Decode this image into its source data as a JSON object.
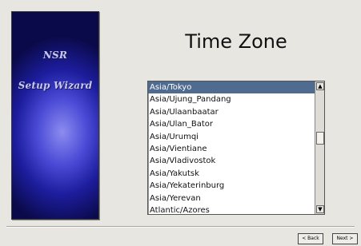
{
  "sidebar": {
    "brand_line1": "NSR",
    "brand_line2": "Setup Wizard"
  },
  "page": {
    "title": "Time Zone"
  },
  "timezone_list": {
    "items": [
      "Asia/Tokyo",
      "Asia/Ujung_Pandang",
      "Asia/Ulaanbaatar",
      "Asia/Ulan_Bator",
      "Asia/Urumqi",
      "Asia/Vientiane",
      "Asia/Vladivostok",
      "Asia/Yakutsk",
      "Asia/Yekaterinburg",
      "Asia/Yerevan",
      "Atlantic/Azores"
    ],
    "selected": "Asia/Tokyo"
  },
  "scrollbar": {
    "up_glyph": "▲",
    "down_glyph": "▼"
  },
  "buttons": {
    "back": "< Back",
    "next": "Next >"
  }
}
